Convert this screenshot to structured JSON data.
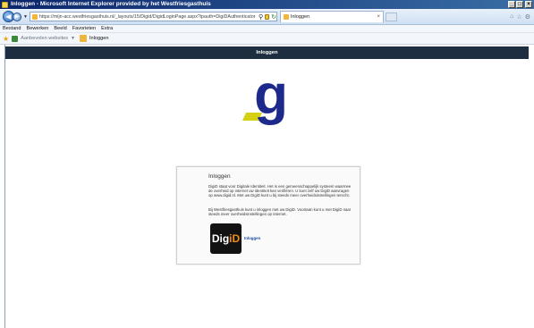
{
  "window": {
    "title": "Inloggen - Microsoft Internet Explorer provided by het Westfriesgasthuis",
    "controls": {
      "minimize": "_",
      "maximize": "□",
      "close": "×"
    }
  },
  "navbar": {
    "back_glyph": "◀",
    "forward_glyph": "▶",
    "address_url": "https://mijn-acc.westfriesgasthuis.nl/_layouts/15/Digid/DigidLoginPage.aspx?ipauth=DigiDAuthenticator",
    "tab_label": "Inloggen"
  },
  "menubar": {
    "items": [
      "Bestand",
      "Bewerken",
      "Beeld",
      "Favorieten",
      "Extra"
    ]
  },
  "favbar": {
    "suggested": "Aanbevolen websites",
    "link": "Inloggen"
  },
  "site": {
    "header_title": "Inloggen"
  },
  "logo": {
    "letter": "g"
  },
  "card": {
    "title": "Inloggen",
    "paragraph1": "DigiD staat voor Digitale Identiteit. Het is een gemeenschappelijk systeem waarmee de overheid op internet uw identiteit kan verifiëren. U kunt zelf uw DigiD aanvragen op www.digid.nl. Met uw DigiD kunt u bij steeds meer overheidsinstellingen terecht.",
    "paragraph2": "Bij Westfriesgasthuis kunt u inloggen met uw DigiD. Voortaan kunt u met DigiD naar steeds meer overheidsinstellingen op internet.",
    "digid_logo_part1": "Dig",
    "digid_logo_part2": "iD",
    "link": "Inloggen"
  },
  "colors": {
    "header_bg": "#1c2e40",
    "logo_blue": "#1d2a8c",
    "logo_yellow": "#d6d012",
    "link": "#1e4fa0"
  }
}
